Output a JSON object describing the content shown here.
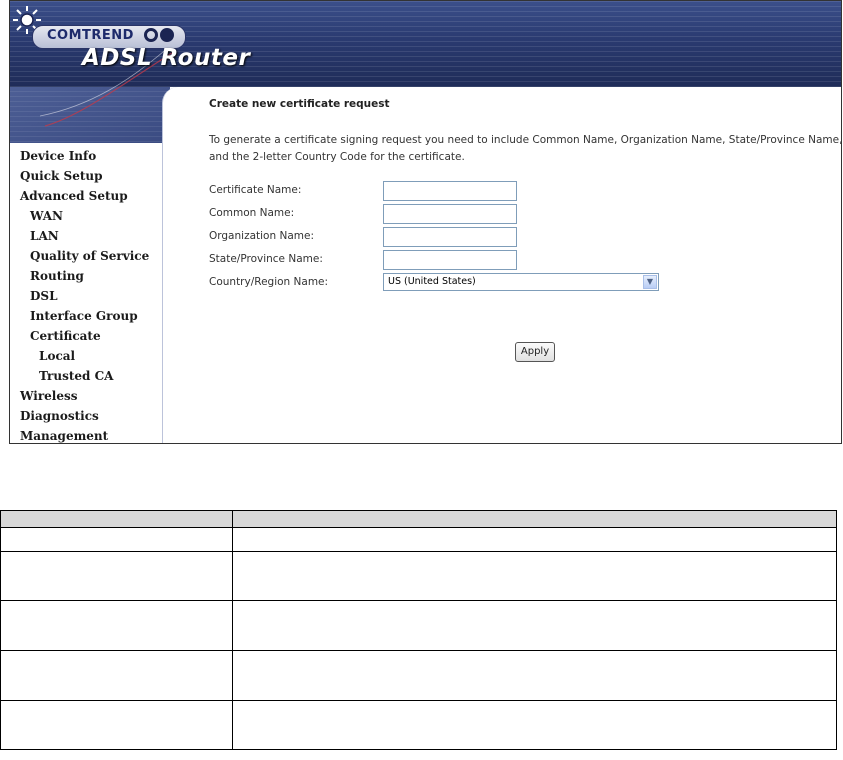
{
  "brand": {
    "logo_text": "COMTREND",
    "product_title": "ADSL Router"
  },
  "sidebar": {
    "items": [
      {
        "label": "Device Info"
      },
      {
        "label": "Quick Setup"
      },
      {
        "label": "Advanced Setup"
      },
      {
        "label": "WAN"
      },
      {
        "label": "LAN"
      },
      {
        "label": "Quality of Service"
      },
      {
        "label": "Routing"
      },
      {
        "label": "DSL"
      },
      {
        "label": "Interface Group"
      },
      {
        "label": "Certificate"
      },
      {
        "label": "Local"
      },
      {
        "label": "Trusted CA"
      },
      {
        "label": "Wireless"
      },
      {
        "label": "Diagnostics"
      },
      {
        "label": "Management"
      }
    ]
  },
  "main": {
    "title": "Create new certificate request",
    "description_line1": "To generate a certificate signing request you need to include Common Name, Organization Name, State/Province Name,",
    "description_line2": "and the 2-letter Country Code for the certificate.",
    "fields": [
      {
        "label": "Certificate Name:",
        "value": ""
      },
      {
        "label": "Common Name:",
        "value": ""
      },
      {
        "label": "Organization Name:",
        "value": ""
      },
      {
        "label": "State/Province Name:",
        "value": ""
      }
    ],
    "country": {
      "label": "Country/Region Name:",
      "selected": "US (United States)"
    },
    "apply_label": "Apply"
  },
  "colors": {
    "banner_dark": "#1f2c58",
    "banner_light": "#5c6ea4",
    "field_border": "#7f9db9"
  }
}
